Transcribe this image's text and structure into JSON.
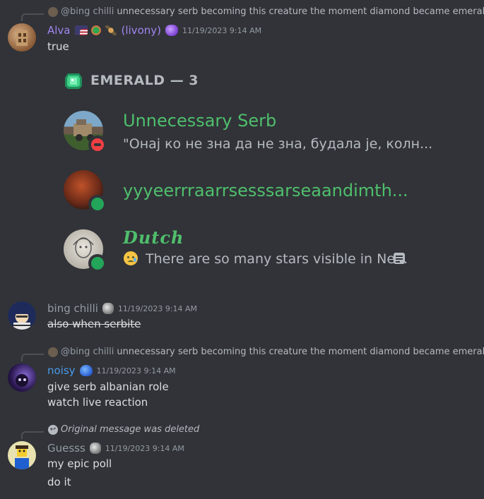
{
  "messages": [
    {
      "reply": {
        "mention": "@bing chilli",
        "text": "unnecessary serb becoming this creature the moment diamond became emerald"
      },
      "author": "Alva",
      "author_suffix": "(livony)",
      "author_color": "#a285f0",
      "timestamp": "11/19/2023 9:14 AM",
      "lines": [
        "true"
      ]
    },
    {
      "author": "bing chilli",
      "author_color": "#949ba4",
      "timestamp": "11/19/2023 9:14 AM",
      "lines": [
        "also when serbite"
      ]
    },
    {
      "reply": {
        "mention": "@bing chilli",
        "text": "unnecessary serb becoming this creature the moment diamond became emerald"
      },
      "author": "noisy",
      "author_color": "#4a9ae8",
      "timestamp": "11/19/2023 9:14 AM",
      "lines": [
        "give serb albanian role",
        "watch live reaction"
      ]
    },
    {
      "reply": {
        "text": "Original message was deleted"
      },
      "author": "Guesss",
      "author_color": "#949ba4",
      "timestamp": "11/19/2023 9:14 AM",
      "lines": [
        "my epic poll",
        "do it"
      ]
    }
  ],
  "role_list": {
    "title": "EMERALD — 3",
    "members": [
      {
        "name": "Unnecessary Serb",
        "status": "\"Онај ко не зна да не зна, будала је, колн...",
        "presence": "dnd",
        "name_color": "#4fbf6c"
      },
      {
        "name": "yyyeerrraarrsesssarseaandimth...",
        "status": "",
        "presence": "online",
        "name_color": "#4fbf6c"
      },
      {
        "name": "Dutch",
        "status": "There are so many stars visible in Ne...",
        "presence": "online",
        "name_color": "#4fbf6c"
      }
    ]
  },
  "colors": {
    "background": "#313338",
    "text": "#dbdee1",
    "muted": "#949ba4",
    "online": "#23a55a",
    "dnd": "#f23f43"
  }
}
